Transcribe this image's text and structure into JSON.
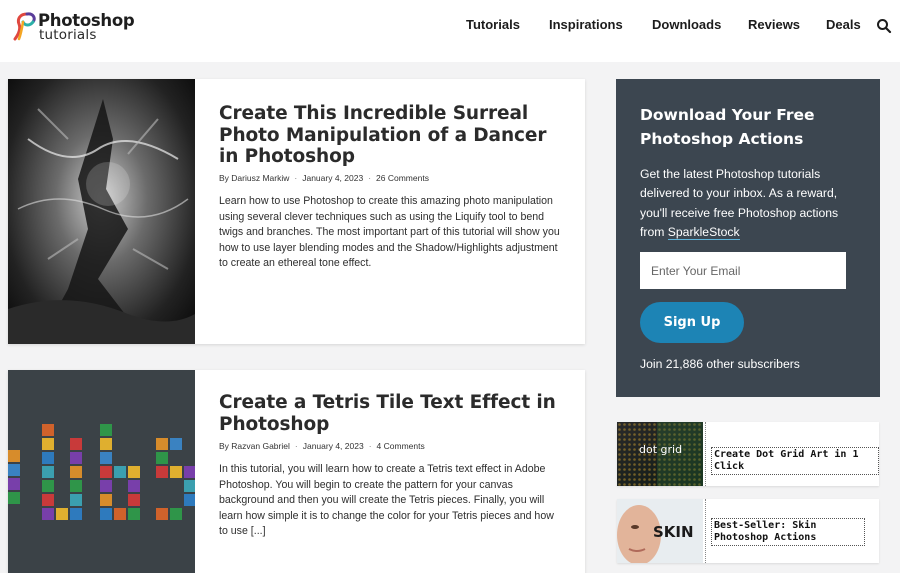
{
  "header": {
    "logo_title": "Photoshop",
    "logo_subtitle": "tutorials",
    "nav": [
      "Tutorials",
      "Inspirations",
      "Downloads",
      "Reviews",
      "Deals"
    ]
  },
  "articles": [
    {
      "title": "Create This Incredible Surreal Photo Manipulation of a Dancer in Photoshop",
      "author": "By Dariusz Markiw",
      "date": "January 4, 2023",
      "comments": "26 Comments",
      "excerpt": "Learn how to use Photoshop to create this amazing photo manipulation using several clever techniques such as using the Liquify tool to bend twigs and branches. The most important part of this tutorial will show you how to use layer blending modes and the Shadow/Highlights adjustment to create an ethereal tone effect."
    },
    {
      "title": "Create a Tetris Tile Text Effect in Photoshop",
      "author": "By Razvan Gabriel",
      "date": "January 4, 2023",
      "comments": "4 Comments",
      "excerpt": "In this tutorial, you will learn how to create a Tetris text effect in Adobe Photoshop. You will begin to create the pattern for your canvas background and then you will create the Tetris pieces. Finally, you will learn how simple it is to change the color for your Tetris pieces and how to use [...]"
    }
  ],
  "newsletter": {
    "title": "Download Your Free Photoshop Actions",
    "text_before": "Get the latest Photoshop tutorials delivered to your inbox. As a reward, you'll receive free Photoshop actions from ",
    "link": "SparkleStock",
    "email_placeholder": "Enter Your Email",
    "button": "Sign Up",
    "subscribers": "Join 21,886 other subscribers"
  },
  "promos": [
    {
      "image_text": "dot grid",
      "label": "Create Dot Grid Art in 1 Click"
    },
    {
      "image_text": "SKIN",
      "label": "Best-Seller: Skin Photoshop Actions"
    }
  ],
  "colors": {
    "newsletter_bg": "#3c4650",
    "button": "#1d84b5",
    "link_underline": "#5fb4d9",
    "page_bg": "#f3f3f4"
  },
  "icons": [
    "logo-mark-icon",
    "search-icon"
  ]
}
